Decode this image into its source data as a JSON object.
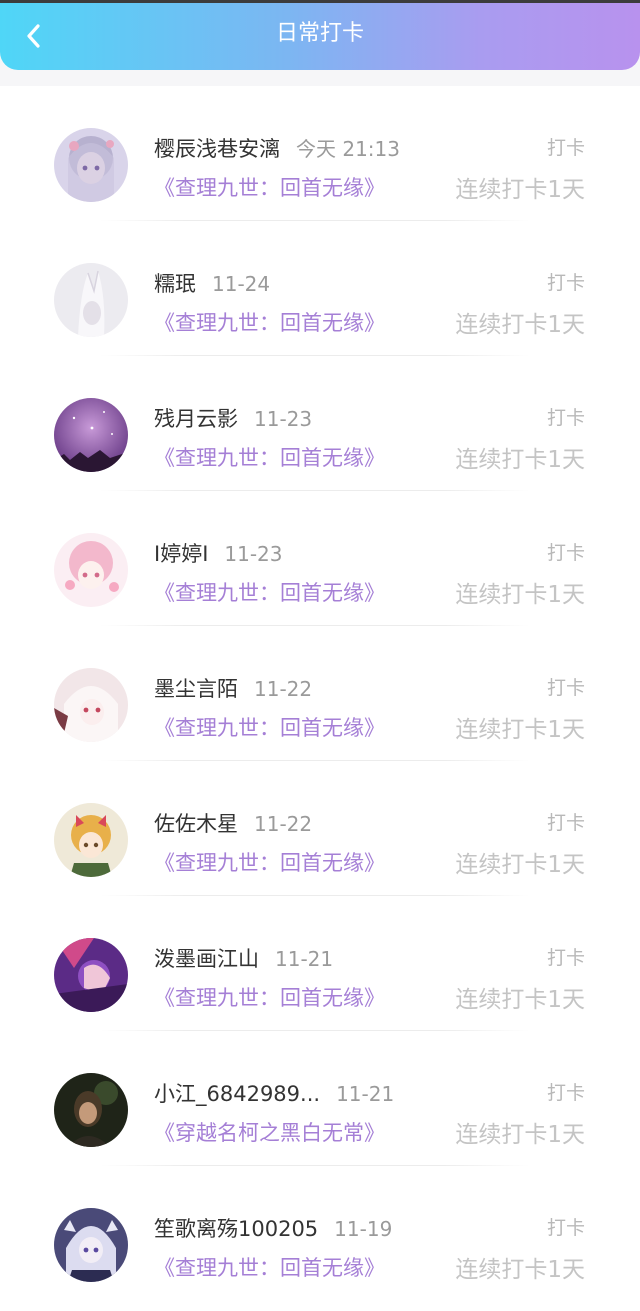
{
  "header": {
    "title": "日常打卡",
    "back_icon": "chevron-left-icon",
    "gradient": [
      "#4fd6f7",
      "#b892ee"
    ]
  },
  "colors": {
    "book": "#a57fd6",
    "streak": "#c4c4c4",
    "date": "#9a9a9a",
    "action": "#b8b8b8"
  },
  "records": [
    {
      "name": "樱辰浅巷安漓",
      "date": "今天 21:13",
      "action": "打卡",
      "book": "《查理九世：回首无缘》",
      "streak": "连续打卡1天"
    },
    {
      "name": "糯珉",
      "date": "11-24",
      "action": "打卡",
      "book": "《查理九世：回首无缘》",
      "streak": "连续打卡1天"
    },
    {
      "name": "残月云影",
      "date": "11-23",
      "action": "打卡",
      "book": "《查理九世：回首无缘》",
      "streak": "连续打卡1天"
    },
    {
      "name": "I婷婷I",
      "date": "11-23",
      "action": "打卡",
      "book": "《查理九世：回首无缘》",
      "streak": "连续打卡1天"
    },
    {
      "name": "墨尘言陌",
      "date": "11-22",
      "action": "打卡",
      "book": "《查理九世：回首无缘》",
      "streak": "连续打卡1天"
    },
    {
      "name": "佐佐木星",
      "date": "11-22",
      "action": "打卡",
      "book": "《查理九世：回首无缘》",
      "streak": "连续打卡1天"
    },
    {
      "name": "泼墨画江山",
      "date": "11-21",
      "action": "打卡",
      "book": "《查理九世：回首无缘》",
      "streak": "连续打卡1天"
    },
    {
      "name": "小江_6842989...",
      "date": "11-21",
      "action": "打卡",
      "book": "《穿越名柯之黑白无常》",
      "streak": "连续打卡1天"
    },
    {
      "name": "笙歌离殇100205",
      "date": "11-19",
      "action": "打卡",
      "book": "《查理九世：回首无缘》",
      "streak": "连续打卡1天"
    }
  ]
}
